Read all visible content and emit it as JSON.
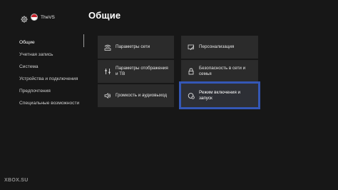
{
  "profile": {
    "gamertag": "TheVS"
  },
  "page": {
    "title": "Общие"
  },
  "sidebar": {
    "items": [
      {
        "label": "Общие",
        "active": true
      },
      {
        "label": "Учетная запись"
      },
      {
        "label": "Система"
      },
      {
        "label": "Устройства и подключения"
      },
      {
        "label": "Предпочтения"
      },
      {
        "label": "Специальные возможности"
      }
    ]
  },
  "tiles": {
    "network": {
      "label": "Параметры сети",
      "icon": "network-icon"
    },
    "display": {
      "label": "Параметры отображения и ТВ",
      "icon": "display-icon"
    },
    "volume": {
      "label": "Громкость и аудиовыход",
      "icon": "speaker-icon"
    },
    "personalization": {
      "label": "Персонализация",
      "icon": "personalization-icon"
    },
    "security": {
      "label": "Безопасность в сети и семья",
      "icon": "lock-icon"
    },
    "power": {
      "label": "Режим включения и запуск",
      "icon": "power-icon",
      "selected": true
    }
  },
  "watermark": "XBOX.SU",
  "colors": {
    "background": "#171717",
    "tile": "#2b2b2b",
    "selection": "#3457b6",
    "brand_red": "#c8232c"
  }
}
